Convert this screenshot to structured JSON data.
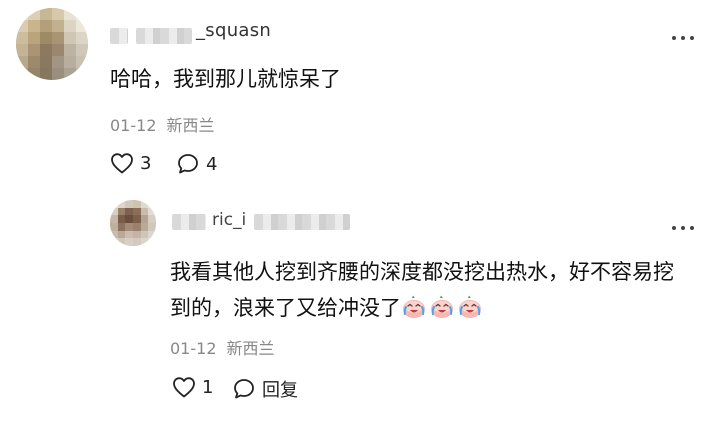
{
  "comment": {
    "username_visible": "_squash",
    "text": "哈哈，我到那儿就惊呆了",
    "date": "01-12",
    "location": "新西兰",
    "like_count": "3",
    "comment_count": "4"
  },
  "reply": {
    "username_visible": "ric_i",
    "text": "我看其他人挖到齐腰的深度都没挖出热水，好不容易挖到的，浪来了又给冲没了",
    "date": "01-12",
    "location": "新西兰",
    "like_count": "1",
    "reply_label": "回复",
    "emoji_icon": "crying-laughing-peach-emoji"
  },
  "colors": {
    "meta_text": "#888888",
    "body_text": "#111111",
    "icon": "#222222"
  }
}
